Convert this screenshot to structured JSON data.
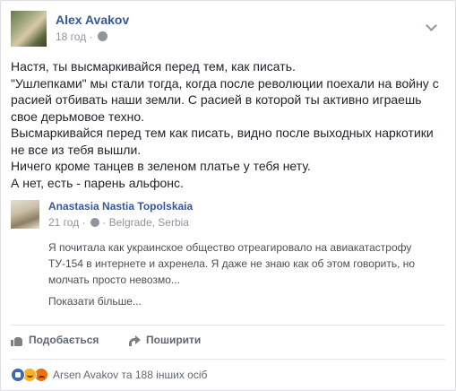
{
  "post": {
    "author": "Alex Avakov",
    "time": "18 год",
    "privacy_icon": "globe-icon",
    "menu_icon": "chevron-down-icon",
    "lines": [
      "Настя, ты высмаркивайся перед тем, как писать.",
      "\"Ушлепками\" мы стали тогда, когда после революции поехали на войну с",
      "расией отбивать наши земли. С расией в которой ты активно играешь",
      "свое дерьмовое техно.",
      "Высмаркивайся перед тем как писать, видно после выходных наркотики",
      "не все из тебя вышли.",
      "Ничего кроме танцев в зеленом платье у тебя нету.",
      "А нет, есть - парень альфонс."
    ]
  },
  "shared_post": {
    "author": "Anastasia Nastia Topolskaia",
    "time": "21 год",
    "separator": "·",
    "location": "Belgrade, Serbia",
    "lines": [
      "Я почитала как украинское общество отреагировало на авиакатастрофу",
      "ТУ-154 в интернете и ахренела. Я даже не знаю как об этом говорить, но",
      "молчать просто невозмо..."
    ],
    "see_more": "Показати більше..."
  },
  "actions": {
    "like_label": "Подобається",
    "share_label": "Поширити"
  },
  "reactions": {
    "icons": [
      "like-reaction-icon",
      "haha-reaction-icon",
      "angry-reaction-icon"
    ],
    "summary": "Arsen Avakov та 188 інших осіб"
  },
  "colors": {
    "link_blue": "#365899",
    "meta_grey": "#90949c",
    "text_dark": "#1d2129",
    "like_blue": "#4267b2"
  }
}
